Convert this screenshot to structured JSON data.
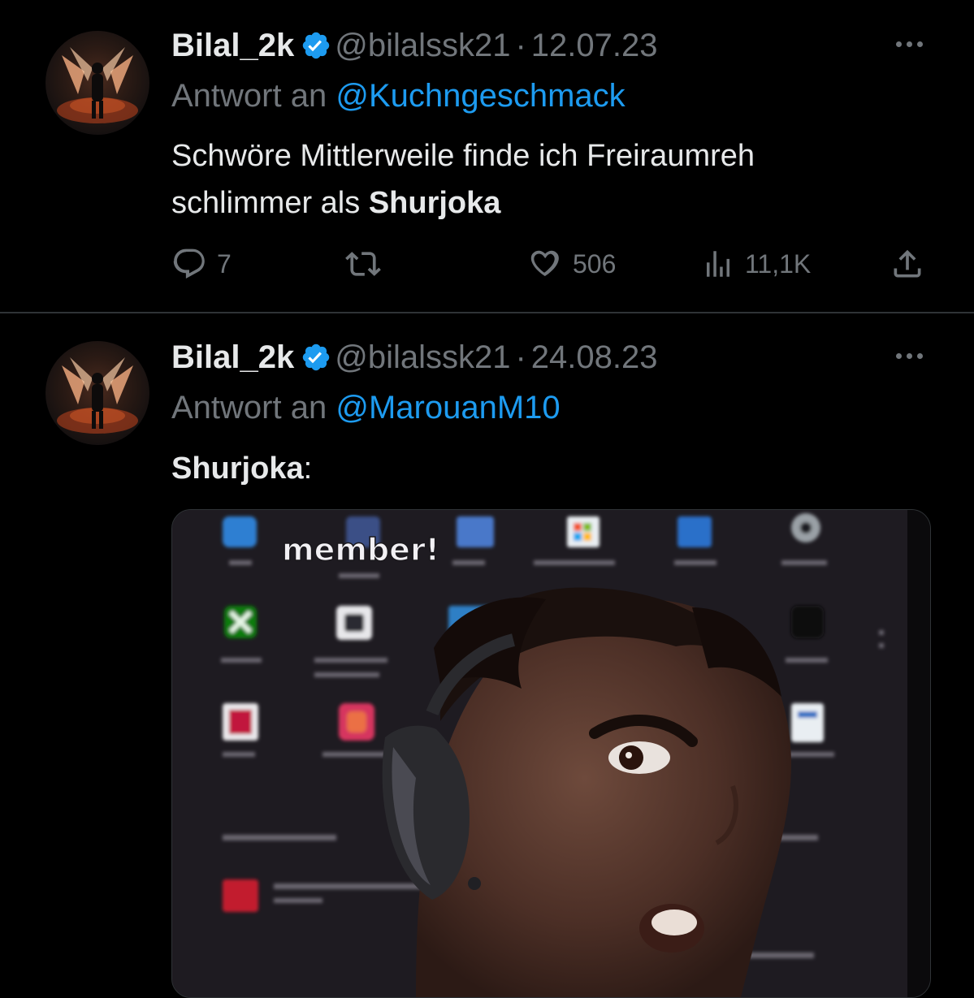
{
  "colors": {
    "background": "#000000",
    "text": "#e7e9ea",
    "muted": "#71767b",
    "link": "#1d9bf0",
    "verified": "#1d9bf0",
    "divider": "#2f3336"
  },
  "tweets": [
    {
      "name": "Bilal_2k",
      "handle": "@bilalssk21",
      "separator": "·",
      "date": "12.07.23",
      "reply_prefix": "Antwort an",
      "reply_to": "@Kuchngeschmack",
      "text_line1": "Schwöre Mittlerweile finde ich Freiraumreh",
      "text_line2_prefix": "schlimmer als ",
      "text_line2_bold": "Shurjoka",
      "metrics": {
        "replies": "7",
        "retweets": "",
        "likes": "506",
        "views": "11,1K"
      },
      "icons": [
        "verified-badge-icon",
        "more-icon",
        "reply-icon",
        "retweet-icon",
        "like-icon",
        "views-icon",
        "share-icon"
      ]
    },
    {
      "name": "Bilal_2k",
      "handle": "@bilalssk21",
      "separator": "·",
      "date": "24.08.23",
      "reply_prefix": "Antwort an",
      "reply_to": "@MarouanM10",
      "text_bold": "Shurjoka",
      "text_rest": ":",
      "media": {
        "caption": "member!"
      }
    }
  ]
}
